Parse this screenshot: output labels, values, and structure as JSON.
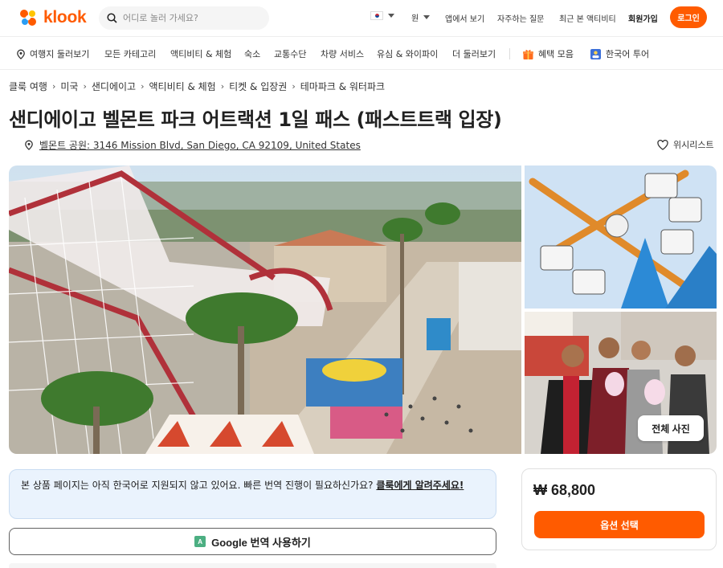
{
  "header": {
    "logo_text": "klook",
    "search_placeholder": "어디로 놀러 가세요?",
    "currency": "원",
    "links": [
      "앱에서 보기",
      "자주하는 질문",
      "최근 본 액티비티",
      "회원가입"
    ],
    "login_label": "로그인"
  },
  "nav": {
    "destinations": "여행지 둘러보기",
    "categories": "모든 카테고리",
    "items": [
      "액티비티 & 체험",
      "숙소",
      "교통수단",
      "차량 서비스",
      "유심 & 와이파이",
      "더 둘러보기"
    ],
    "deals": "혜택 모음",
    "korean_tour": "한국어 투어"
  },
  "breadcrumb": [
    "클룩 여행",
    "미국",
    "샌디에이고",
    "액티비티 & 체험",
    "티켓 & 입장권",
    "테마파크 & 워터파크"
  ],
  "product": {
    "title": "샌디에이고 벨몬트 파크 어트랙션 1일 패스 (패스트트랙 입장)",
    "address": "벨몬트 공원: 3146 Mission Blvd, San Diego, CA 92109, United States",
    "wishlist_label": "위시리스트",
    "all_photos_label": "전체 사진"
  },
  "notice": {
    "text": "본 상품 페이지는 아직 한국어로 지원되지 않고 있어요. 빠른 번역 진행이 필요하신가요? ",
    "link": "클룩에게 알려주세요!"
  },
  "translate_button": "Google 번역 사용하기",
  "price": {
    "amount": "₩ 68,800",
    "button": "옵션 선택"
  },
  "colors": {
    "brand": "#ff5b00",
    "notice_bg": "#eaf3fd"
  }
}
